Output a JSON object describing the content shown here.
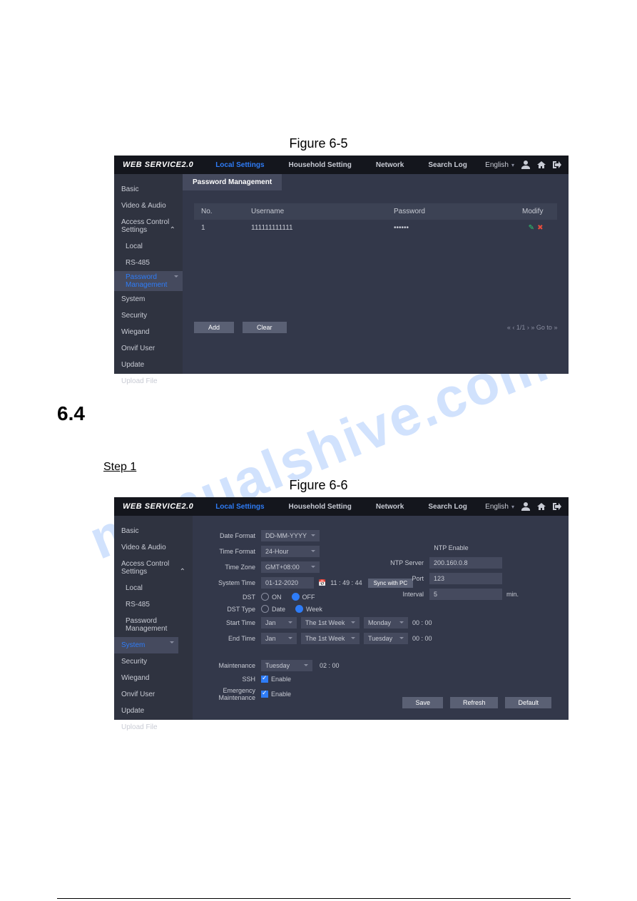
{
  "captions": {
    "fig65": "Figure 6-5",
    "fig66": "Figure 6-6"
  },
  "section": "6.4",
  "step": "Step 1",
  "brand": "WEB SERVICE2.0",
  "nav": {
    "local": "Local Settings",
    "household": "Household Setting",
    "network": "Network",
    "search": "Search Log"
  },
  "topright": {
    "lang": "English"
  },
  "sidebar": {
    "basic": "Basic",
    "video": "Video & Audio",
    "acs": "Access Control Settings",
    "local": "Local",
    "rs485": "RS-485",
    "pwmgmt": "Password Management",
    "system": "System",
    "security": "Security",
    "wiegand": "Wiegand",
    "onvif": "Onvif User",
    "update": "Update",
    "upload": "Upload File"
  },
  "fig65": {
    "tab": "Password Management",
    "headers": {
      "no": "No.",
      "user": "Username",
      "pw": "Password",
      "mod": "Modify"
    },
    "row": {
      "no": "1",
      "user": "111111111111",
      "pw": "••••••"
    },
    "add": "Add",
    "clear": "Clear",
    "pager": "« ‹ 1/1 › »  Go to     »"
  },
  "fig66": {
    "labels": {
      "dateFormat": "Date Format",
      "timeFormat": "Time Format",
      "timeZone": "Time Zone",
      "sysTime": "System Time",
      "dst": "DST",
      "dstType": "DST Type",
      "start": "Start Time",
      "end": "End Time",
      "maint": "Maintenance",
      "ssh": "SSH",
      "emerg": "Emergency Maintenance",
      "enable": "Enable",
      "ntpEnable": "NTP Enable",
      "ntpServer": "NTP Server",
      "port": "Port",
      "interval": "Interval",
      "min": "min."
    },
    "values": {
      "dateFormat": "DD-MM-YYYY",
      "timeFormat": "24-Hour",
      "timeZone": "GMT+08:00",
      "sysDate": "01-12-2020",
      "sysTime": "11 : 49 : 44",
      "sync": "Sync with PC",
      "on": "ON",
      "off": "OFF",
      "date": "Date",
      "week": "Week",
      "startMonth": "Jan",
      "startWk": "The 1st Week",
      "startDay": "Monday",
      "startTime": "00 : 00",
      "endMonth": "Jan",
      "endWk": "The 1st Week",
      "endDay": "Tuesday",
      "endTime": "00 : 00",
      "maintDay": "Tuesday",
      "maintTime": "02 : 00",
      "ntpServer": "200.160.0.8",
      "port": "123",
      "interval": "5"
    },
    "buttons": {
      "save": "Save",
      "refresh": "Refresh",
      "default": "Default"
    }
  }
}
